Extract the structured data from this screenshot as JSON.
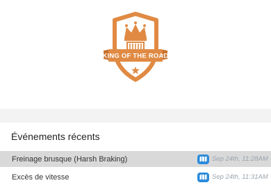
{
  "badge": {
    "title": "KING OF THE ROAD",
    "accent_color": "#e08a43",
    "icon": "crown-truck-badge-icon"
  },
  "events_section": {
    "title": "Événements récents",
    "items": [
      {
        "label": "Freinage brusque (Harsh Braking)",
        "time": "Sep 24th, 11:28AM",
        "icon": "map-icon"
      },
      {
        "label": "Excès de vitesse",
        "time": "Sep 24th, 11:31AM",
        "icon": "map-icon"
      }
    ]
  }
}
